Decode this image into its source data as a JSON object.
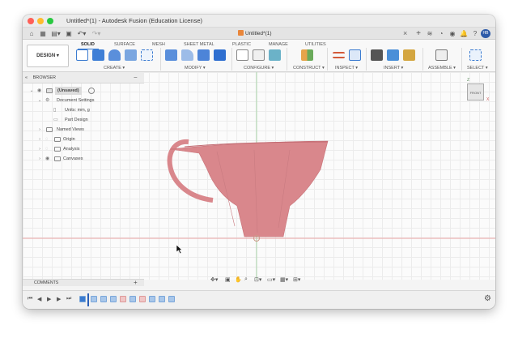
{
  "window": {
    "title": "Untitled*(1) - Autodesk Fusion (Education License)"
  },
  "quickbar": {
    "doc_tab": "Untitled*(1)",
    "close": "×",
    "add": "+",
    "avatar": "HB"
  },
  "ribbon": {
    "workspace": "DESIGN ▾",
    "tabs": [
      "SOLID",
      "SURFACE",
      "MESH",
      "SHEET METAL",
      "PLASTIC",
      "MANAGE",
      "UTILITIES"
    ],
    "active_tab": "SOLID",
    "groups": [
      "CREATE ▾",
      "MODIFY ▾",
      "CONFIGURE ▾",
      "CONSTRUCT ▾",
      "INSPECT ▾",
      "INSERT ▾",
      "ASSEMBLE ▾",
      "SELECT ▾"
    ]
  },
  "browser": {
    "title": "BROWSER",
    "collapse": "−",
    "items": [
      {
        "label": "(Unsaved)",
        "level": 0
      },
      {
        "label": "Document Settings",
        "level": 1
      },
      {
        "label": "Units: mm, g",
        "level": 2
      },
      {
        "label": "Part Design",
        "level": 2
      },
      {
        "label": "Named Views",
        "level": 1
      },
      {
        "label": "Origin",
        "level": 1
      },
      {
        "label": "Analysis",
        "level": 1
      },
      {
        "label": "Canvases",
        "level": 1
      }
    ]
  },
  "viewcube": {
    "label": "FRONT",
    "z": "Z",
    "x": "X"
  },
  "comments": {
    "label": "COMMENTS",
    "add": "+"
  },
  "timeline": {
    "controls": [
      "⏮",
      "◀",
      "▶",
      "▶",
      "⏭"
    ]
  },
  "colors": {
    "model": "#d9878c",
    "accent": "#3b7bd0",
    "axis_red": "#e89a9a",
    "axis_green": "#9ccf9c"
  }
}
